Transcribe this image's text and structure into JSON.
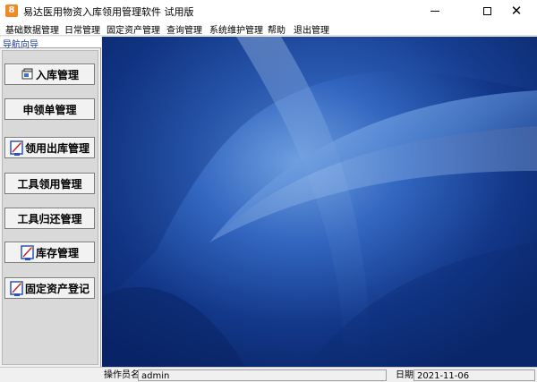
{
  "window": {
    "title": "易达医用物资入库领用管理软件 试用版",
    "app_icon": "app-logo-icon"
  },
  "menu": [
    "基础数据管理",
    "日常管理",
    "固定资产管理",
    "查询管理",
    "系统维护管理",
    "帮助",
    "退出管理"
  ],
  "nav": {
    "header": "导航向导",
    "buttons": [
      {
        "label": "入库管理",
        "icon": "stock-in-icon"
      },
      {
        "label": "申领单管理",
        "icon": ""
      },
      {
        "label": "领用出库管理",
        "icon": "stock-out-icon"
      },
      {
        "label": "工具领用管理",
        "icon": ""
      },
      {
        "label": "工具归还管理",
        "icon": ""
      },
      {
        "label": "库存管理",
        "icon": "inventory-icon"
      },
      {
        "label": "固定资产登记",
        "icon": "asset-register-icon"
      }
    ]
  },
  "status": {
    "operator_label": "操作员名",
    "operator_value": "admin",
    "date_label": "日期",
    "date_value": "2021-11-06"
  },
  "colors": {
    "desktop_dark": "#0a2a6e",
    "desktop_light": "#8ab4e8",
    "nav_header_text": "#1a3a9a",
    "app_icon": "#f08a24"
  }
}
